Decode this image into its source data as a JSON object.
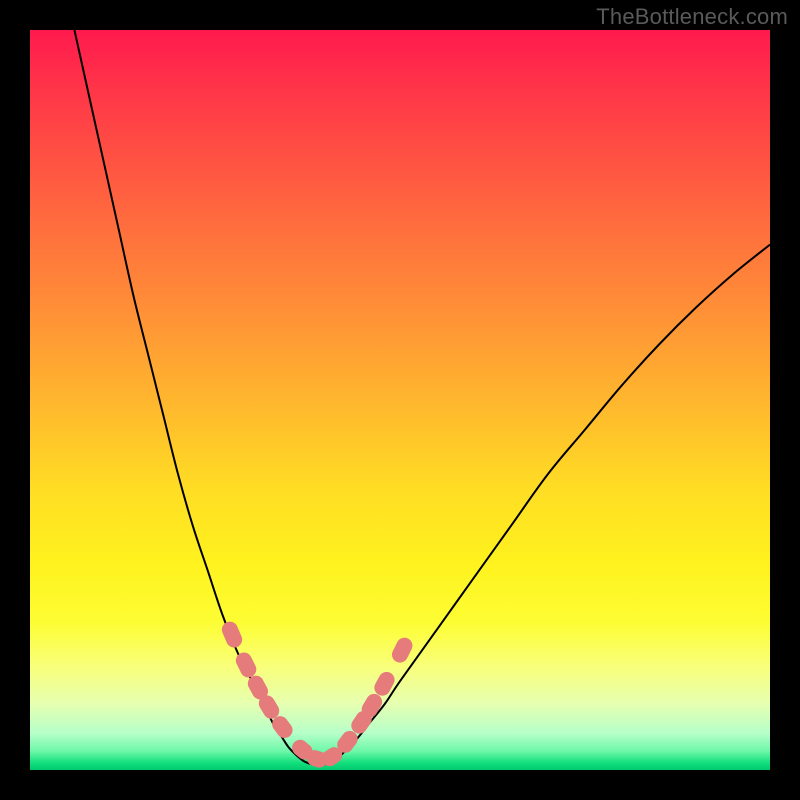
{
  "attribution": "TheBottleneck.com",
  "colors": {
    "page_bg": "#000000",
    "gradient_top": "#ff1a4d",
    "gradient_bottom": "#00c96e",
    "curve": "#000000",
    "marker": "#e57b7b"
  },
  "chart_data": {
    "type": "line",
    "title": "",
    "xlabel": "",
    "ylabel": "",
    "xlim": [
      0,
      100
    ],
    "ylim": [
      0,
      100
    ],
    "grid": false,
    "legend": false,
    "series": [
      {
        "name": "curve-left",
        "x": [
          6,
          8,
          10,
          12,
          14,
          16,
          18,
          20,
          22,
          24,
          26,
          28,
          30,
          32,
          33,
          34,
          35,
          36
        ],
        "y": [
          100,
          91,
          82,
          73,
          64,
          56,
          48,
          40,
          33,
          27,
          21,
          16,
          12,
          8,
          6,
          4.5,
          3,
          2
        ]
      },
      {
        "name": "valley",
        "x": [
          36,
          37,
          38,
          39,
          40,
          41,
          42
        ],
        "y": [
          2,
          1.2,
          0.8,
          0.6,
          0.8,
          1.2,
          2
        ]
      },
      {
        "name": "curve-right",
        "x": [
          42,
          44,
          46,
          48,
          50,
          55,
          60,
          65,
          70,
          75,
          80,
          85,
          90,
          95,
          100
        ],
        "y": [
          2,
          4,
          6.5,
          9,
          12,
          19,
          26,
          33,
          40,
          46,
          52,
          57.5,
          62.5,
          67,
          71
        ]
      }
    ],
    "markers": {
      "name": "highlighted-points",
      "x": [
        27.0,
        27.6,
        28.9,
        29.5,
        30.5,
        31.1,
        32.0,
        32.6,
        33.8,
        34.4,
        36.5,
        37.1,
        38.5,
        39.1,
        40.5,
        41.1,
        42.6,
        43.2,
        44.5,
        45.1,
        45.9,
        46.5,
        47.6,
        48.2,
        50.0,
        50.6
      ],
      "y": [
        19.0,
        17.6,
        14.8,
        13.6,
        11.7,
        10.6,
        9.0,
        8.0,
        6.2,
        5.4,
        3.0,
        2.5,
        1.6,
        1.4,
        1.6,
        2.0,
        3.4,
        4.2,
        6.0,
        6.9,
        8.2,
        9.2,
        11.1,
        12.2,
        15.6,
        16.8
      ]
    }
  }
}
